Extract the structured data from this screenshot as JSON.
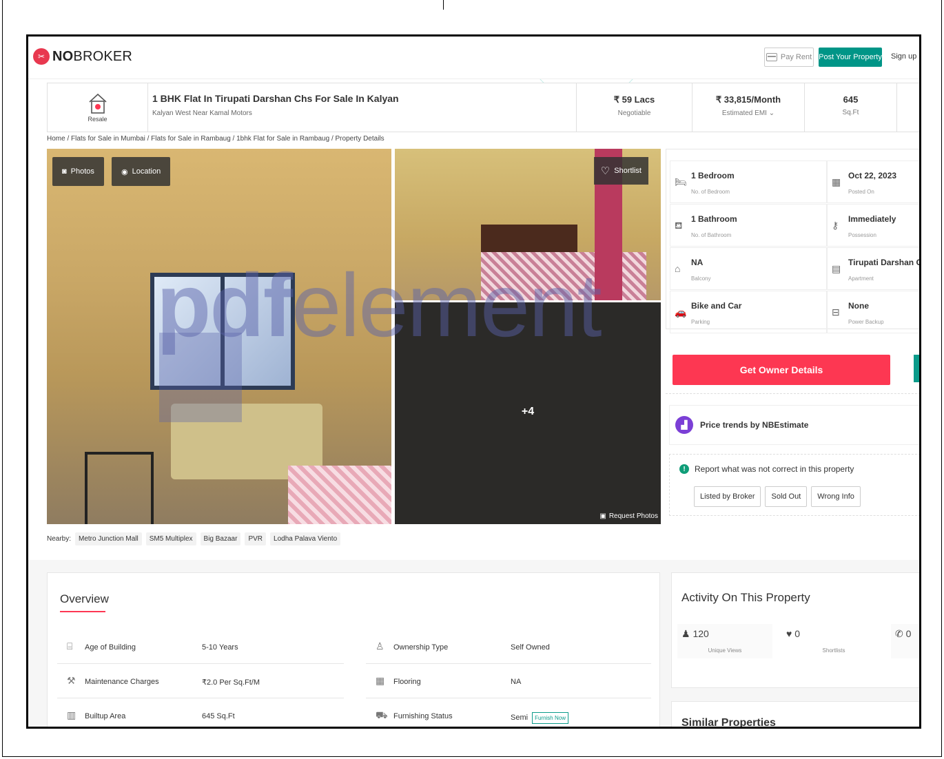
{
  "header": {
    "logo_no": "NO",
    "logo_broker": "BROKER",
    "pay_rent": "Pay Rent",
    "post_property": "Post Your Property",
    "sign_up": "Sign up"
  },
  "property": {
    "type_label": "Resale",
    "title": "1 BHK Flat In Tirupati Darshan Chs For Sale In Kalyan",
    "subtitle": "Kalyan West Near Kamal Motors",
    "price": "₹ 59 Lacs",
    "price_note": "Negotiable",
    "emi": "₹ 33,815/Month",
    "emi_note": "Estimated EMI ⌄",
    "area": "645",
    "area_unit": "Sq.Ft"
  },
  "breadcrumb": "Home / Flats for Sale in Mumbai / Flats for Sale in Rambaug / 1bhk Flat for Sale in Rambaug / Property Details",
  "gallery": {
    "photos_btn": "Photos",
    "location_btn": "Location",
    "shortlist_btn": "Shortlist",
    "more_count": "+4",
    "request_photos": "Request Photos"
  },
  "nearby": {
    "label": "Nearby:",
    "places": [
      "Metro Junction Mall",
      "SM5 Multiplex",
      "Big Bazaar",
      "PVR",
      "Lodha Palava Viento"
    ]
  },
  "details": [
    {
      "value": "1 Bedroom",
      "label": "No. of Bedroom",
      "icon": "bed-icon"
    },
    {
      "value": "Oct 22, 2023",
      "label": "Posted On",
      "icon": "calendar-icon"
    },
    {
      "value": "1 Bathroom",
      "label": "No. of Bathroom",
      "icon": "bath-icon"
    },
    {
      "value": "Immediately",
      "label": "Possession",
      "icon": "key-icon"
    },
    {
      "value": "NA",
      "label": "Balcony",
      "icon": "balcony-icon"
    },
    {
      "value": "Tirupati Darshan Chs",
      "label": "Apartment",
      "icon": "building-icon"
    },
    {
      "value": "Bike and Car",
      "label": "Parking",
      "icon": "car-icon"
    },
    {
      "value": "None",
      "label": "Power Backup",
      "icon": "battery-icon"
    }
  ],
  "actions": {
    "get_owner_details": "Get Owner Details",
    "price_trends": "Price trends by NBEstimate",
    "report_title": "Report what was not correct in this property",
    "report_options": [
      "Listed by Broker",
      "Sold Out",
      "Wrong Info"
    ]
  },
  "overview": {
    "title": "Overview",
    "rows": [
      {
        "label": "Age of Building",
        "value": "5-10 Years"
      },
      {
        "label": "Ownership Type",
        "value": "Self Owned"
      },
      {
        "label": "Maintenance Charges",
        "value": "₹2.0 Per Sq.Ft/M"
      },
      {
        "label": "Flooring",
        "value": "NA"
      },
      {
        "label": "Builtup Area",
        "value": "645 Sq.Ft"
      },
      {
        "label": "Furnishing Status",
        "value": "Semi"
      }
    ],
    "furnish_now": "Furnish Now"
  },
  "activity": {
    "title": "Activity On This Property",
    "unique_views": "120",
    "unique_views_label": "Unique Views",
    "shortlists": "0",
    "shortlists_label": "Shortlists",
    "contacts": "0"
  },
  "similar": {
    "title": "Similar Properties"
  },
  "watermark": {
    "pdf": "pdf",
    "element": "element"
  },
  "colors": {
    "brand_red": "#fd3752",
    "brand_teal": "#009587",
    "nbestimate_purple": "#7b3fd6"
  }
}
